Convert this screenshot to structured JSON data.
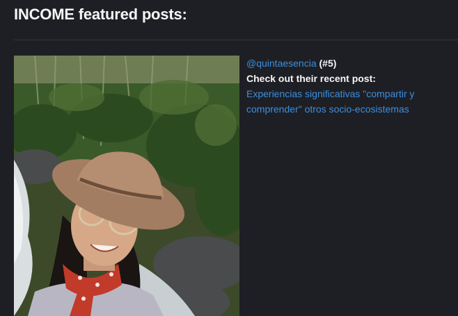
{
  "heading": "INCOME featured posts:",
  "featured": {
    "author": "@quintaesencia",
    "rank": "(#5)",
    "cta": "Check out their recent post:",
    "post_title": "Experiencias significativas \"compartir y comprender\" otros socio-ecosistemas"
  },
  "colors": {
    "background": "#1e1f24",
    "text": "#f5f6f7",
    "link": "#3b8fe0",
    "divider": "#34363c"
  }
}
